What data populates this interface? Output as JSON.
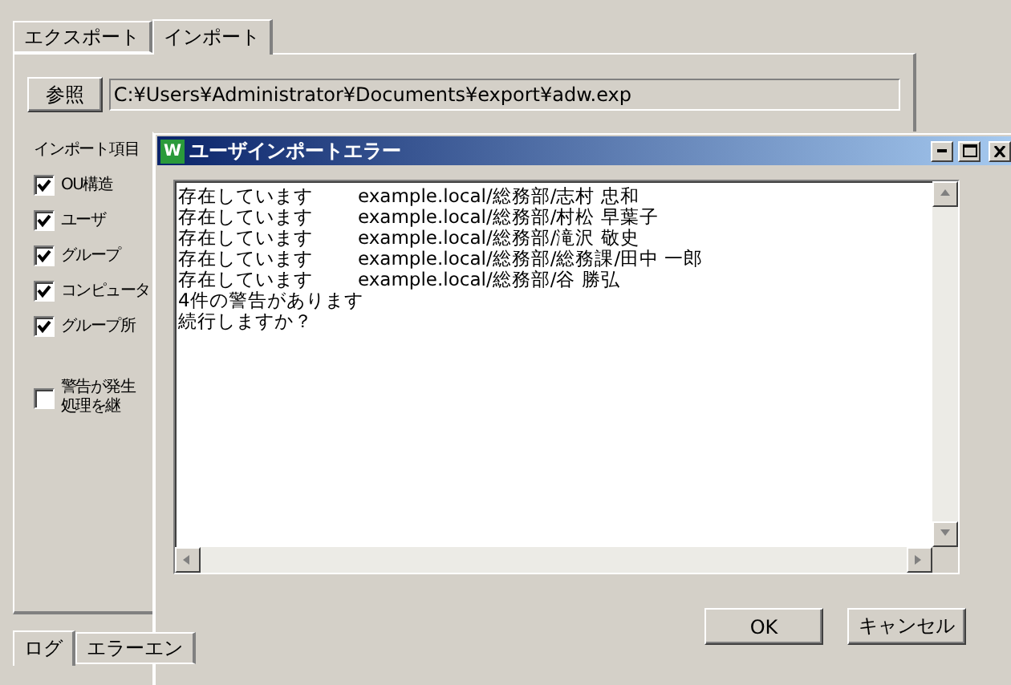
{
  "main_window": {
    "tabs": [
      {
        "label": "エクスポート",
        "selected": false
      },
      {
        "label": "インポート",
        "selected": true
      }
    ],
    "browse_button": "参照",
    "path": "C:¥Users¥Administrator¥Documents¥export¥adw.exp",
    "import_items_label": "インポート項目",
    "import_items": [
      {
        "label": "OU構造",
        "checked": true
      },
      {
        "label": "ユーザ",
        "checked": true
      },
      {
        "label": "グループ",
        "checked": true
      },
      {
        "label": "コンピュータ",
        "checked": true
      },
      {
        "label": "グループ所",
        "checked": true
      }
    ],
    "continue_option": {
      "lines": [
        "警告が発生",
        "処理を継"
      ],
      "checked": false
    },
    "log_tabs": [
      {
        "label": "ログ",
        "selected": true
      },
      {
        "label": "エラーエン",
        "selected": false
      }
    ]
  },
  "dialog": {
    "title": "ユーザインポートエラー",
    "app_icon": "W",
    "messages": [
      {
        "status": "存在しています",
        "path": "example.local/総務部/志村 忠和"
      },
      {
        "status": "存在しています",
        "path": "example.local/総務部/村松 早葉子"
      },
      {
        "status": "存在しています",
        "path": "example.local/総務部/滝沢 敬史"
      },
      {
        "status": "存在しています",
        "path": "example.local/総務部/総務課/田中 一郎"
      },
      {
        "status": "存在しています",
        "path": "example.local/総務部/谷 勝弘"
      }
    ],
    "summary_lines": [
      "4件の警告があります",
      "続行しますか？"
    ],
    "buttons": [
      "OK",
      "キャンセル"
    ]
  }
}
